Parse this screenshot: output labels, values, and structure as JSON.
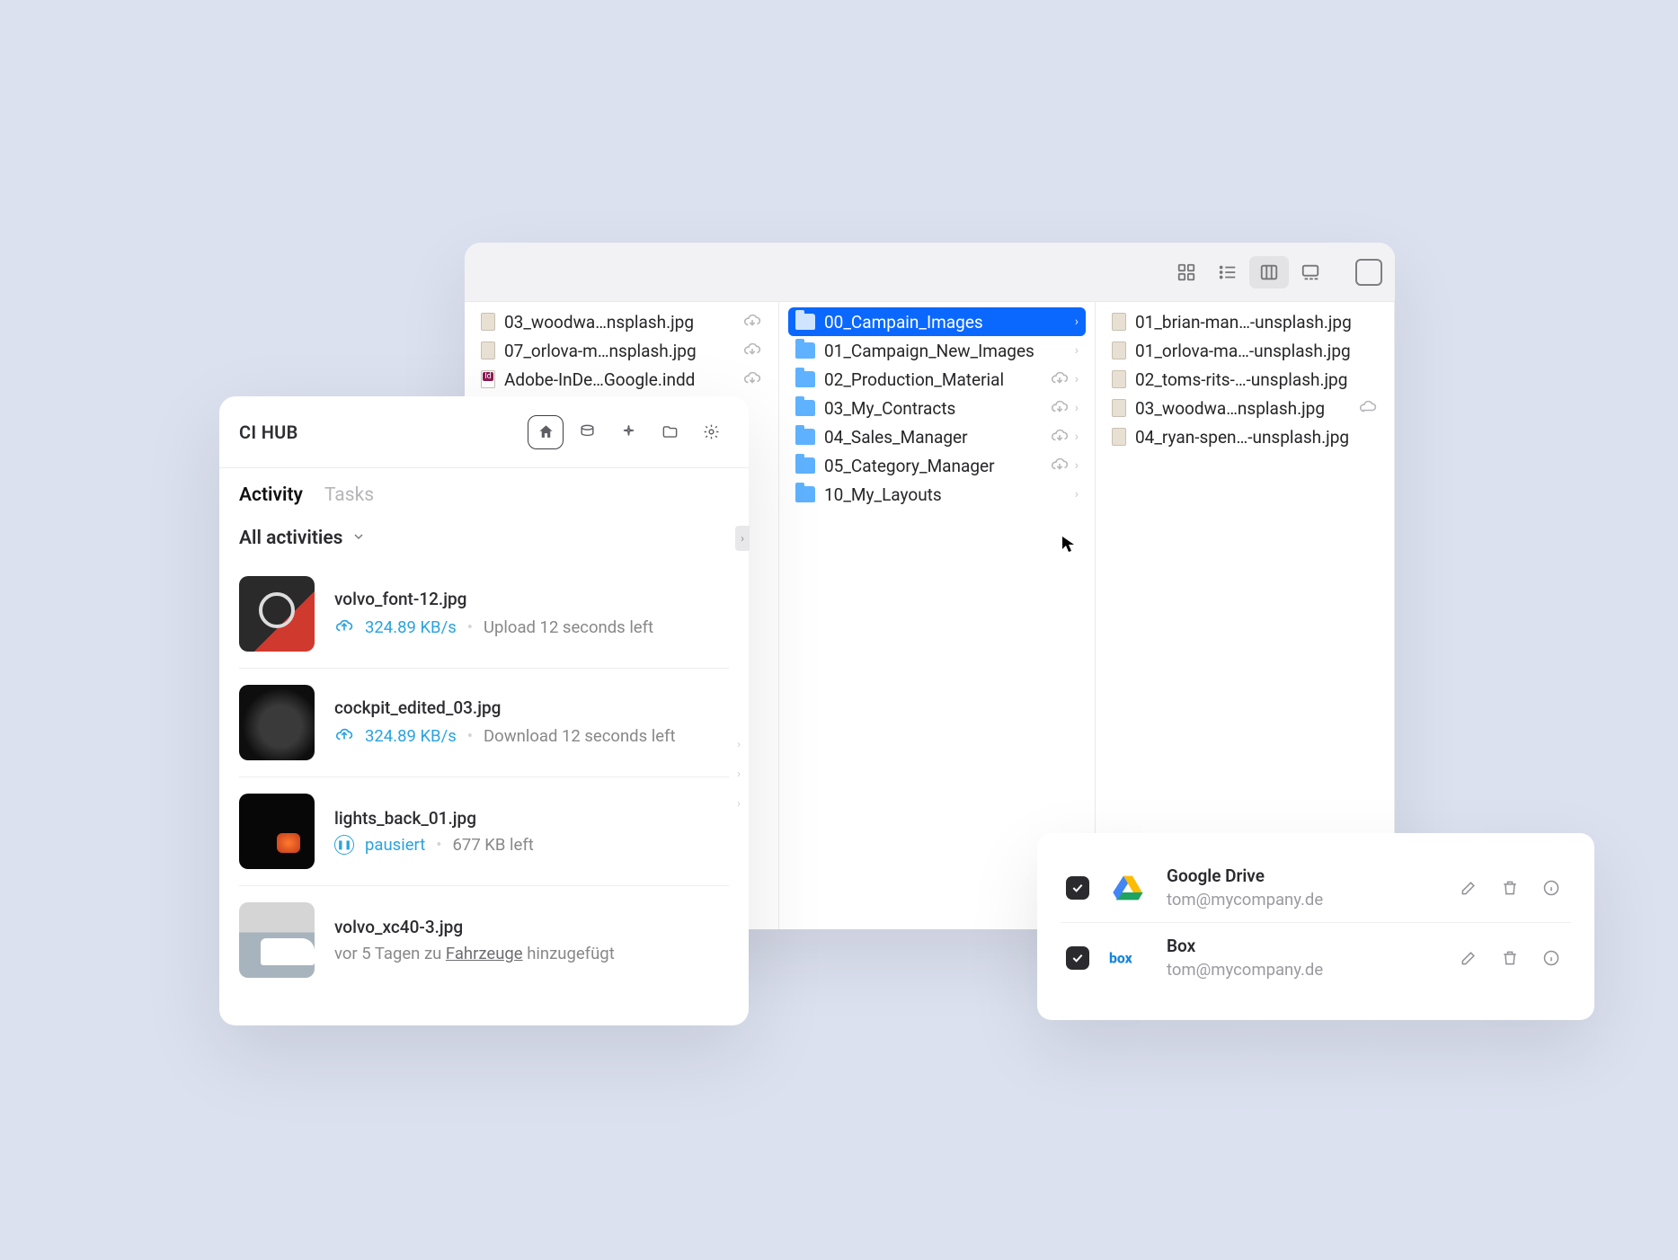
{
  "finder": {
    "col1": [
      {
        "name": "03_woodwa…nsplash.jpg",
        "type": "img",
        "cloud": true
      },
      {
        "name": "07_orlova-m…nsplash.jpg",
        "type": "img",
        "cloud": true
      },
      {
        "name": "Adobe-InDe…Google.indd",
        "type": "indd",
        "cloud": true
      }
    ],
    "col2": [
      {
        "name": "00_Campain_Images",
        "selected": true,
        "chev": true
      },
      {
        "name": "01_Campaign_New_Images",
        "chev": true
      },
      {
        "name": "02_Production_Material",
        "cloud": true,
        "chev": true
      },
      {
        "name": "03_My_Contracts",
        "cloud": true,
        "chev": true
      },
      {
        "name": "04_Sales_Manager",
        "cloud": true,
        "chev": true
      },
      {
        "name": "05_Category_Manager",
        "cloud": true,
        "chev": true
      },
      {
        "name": "10_My_Layouts",
        "chev": true
      }
    ],
    "col3": [
      {
        "name": "01_brian-man…-unsplash.jpg"
      },
      {
        "name": "01_orlova-ma…-unsplash.jpg"
      },
      {
        "name": "02_toms-rits-…-unsplash.jpg"
      },
      {
        "name": "03_woodwa…nsplash.jpg",
        "cloud_plain": true
      },
      {
        "name": "04_ryan-spen…-unsplash.jpg"
      }
    ]
  },
  "cihub": {
    "title": "CI HUB",
    "tabs": {
      "activity": "Activity",
      "tasks": "Tasks"
    },
    "filter": "All activities",
    "items": [
      {
        "name": "volvo_font-12.jpg",
        "rate": "324.89 KB/s",
        "status": "Upload 12 seconds left",
        "mode": "upload",
        "thumb": "volvo-logo"
      },
      {
        "name": "cockpit_edited_03.jpg",
        "rate": "324.89 KB/s",
        "status": "Download 12 seconds left",
        "mode": "upload",
        "thumb": "cockpit"
      },
      {
        "name": "lights_back_01.jpg",
        "paused": "pausiert",
        "remain": "677 KB left",
        "mode": "paused",
        "thumb": "lights"
      },
      {
        "name": "volvo_xc40-3.jpg",
        "ago_pre": "vor 5 Tagen zu ",
        "ago_link": "Fahrzeuge",
        "ago_post": " hinzugefügt",
        "mode": "added",
        "thumb": "xc40"
      }
    ]
  },
  "connections": [
    {
      "name": "Google Drive",
      "email": "tom@mycompany.de",
      "svc": "gdrive"
    },
    {
      "name": "Box",
      "email": "tom@mycompany.de",
      "svc": "box"
    }
  ]
}
